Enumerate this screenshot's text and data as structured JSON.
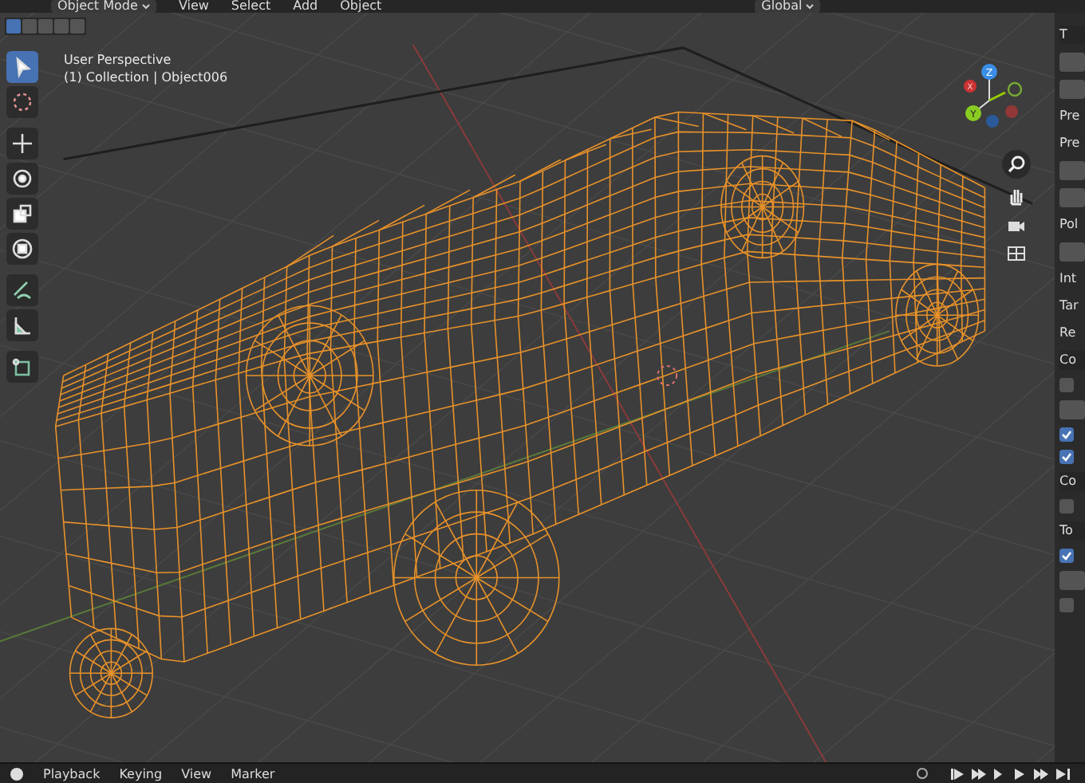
{
  "header": {
    "menus": [
      "View",
      "Select",
      "Add",
      "Object"
    ],
    "mode": "Object Mode",
    "orientation": "Global"
  },
  "select_modes": [
    {
      "selected": true
    },
    {
      "selected": false
    },
    {
      "selected": false
    },
    {
      "selected": false
    },
    {
      "selected": false
    }
  ],
  "viewport": {
    "title": "User Perspective",
    "subtitle": "(1) Collection | Object006"
  },
  "toolbar": [
    {
      "kind": "select",
      "selected": true
    },
    {
      "kind": "cursor",
      "selected": false
    },
    {
      "kind": "move",
      "selected": false
    },
    {
      "kind": "rotate",
      "selected": false
    },
    {
      "kind": "scale",
      "selected": false
    },
    {
      "kind": "transform",
      "selected": false
    },
    {
      "kind": "annotate",
      "selected": false
    },
    {
      "kind": "measure",
      "selected": false
    },
    {
      "kind": "add",
      "selected": false
    }
  ],
  "gizmo": {
    "z": "Z",
    "y": "Y",
    "x": "X"
  },
  "side_panel": [
    {
      "kind": "heading",
      "label": "T"
    },
    {
      "kind": "field"
    },
    {
      "kind": "field"
    },
    {
      "kind": "label",
      "label": "Pre"
    },
    {
      "kind": "label",
      "label": "Pre"
    },
    {
      "kind": "field"
    },
    {
      "kind": "field"
    },
    {
      "kind": "label",
      "label": "Pol"
    },
    {
      "kind": "field"
    },
    {
      "kind": "label",
      "label": "Int"
    },
    {
      "kind": "label",
      "label": "Tar"
    },
    {
      "kind": "label",
      "label": "Re"
    },
    {
      "kind": "heading",
      "label": "Co"
    },
    {
      "kind": "checkbox",
      "checked": false
    },
    {
      "kind": "field"
    },
    {
      "kind": "checkbox",
      "checked": true
    },
    {
      "kind": "checkbox",
      "checked": true
    },
    {
      "kind": "heading",
      "label": "Co"
    },
    {
      "kind": "checkbox",
      "checked": false
    },
    {
      "kind": "heading",
      "label": "To"
    },
    {
      "kind": "checkbox",
      "checked": true
    },
    {
      "kind": "field"
    },
    {
      "kind": "checkbox",
      "checked": false
    }
  ],
  "timeline": {
    "menus": [
      "Playback",
      "Keying",
      "View",
      "Marker"
    ]
  }
}
